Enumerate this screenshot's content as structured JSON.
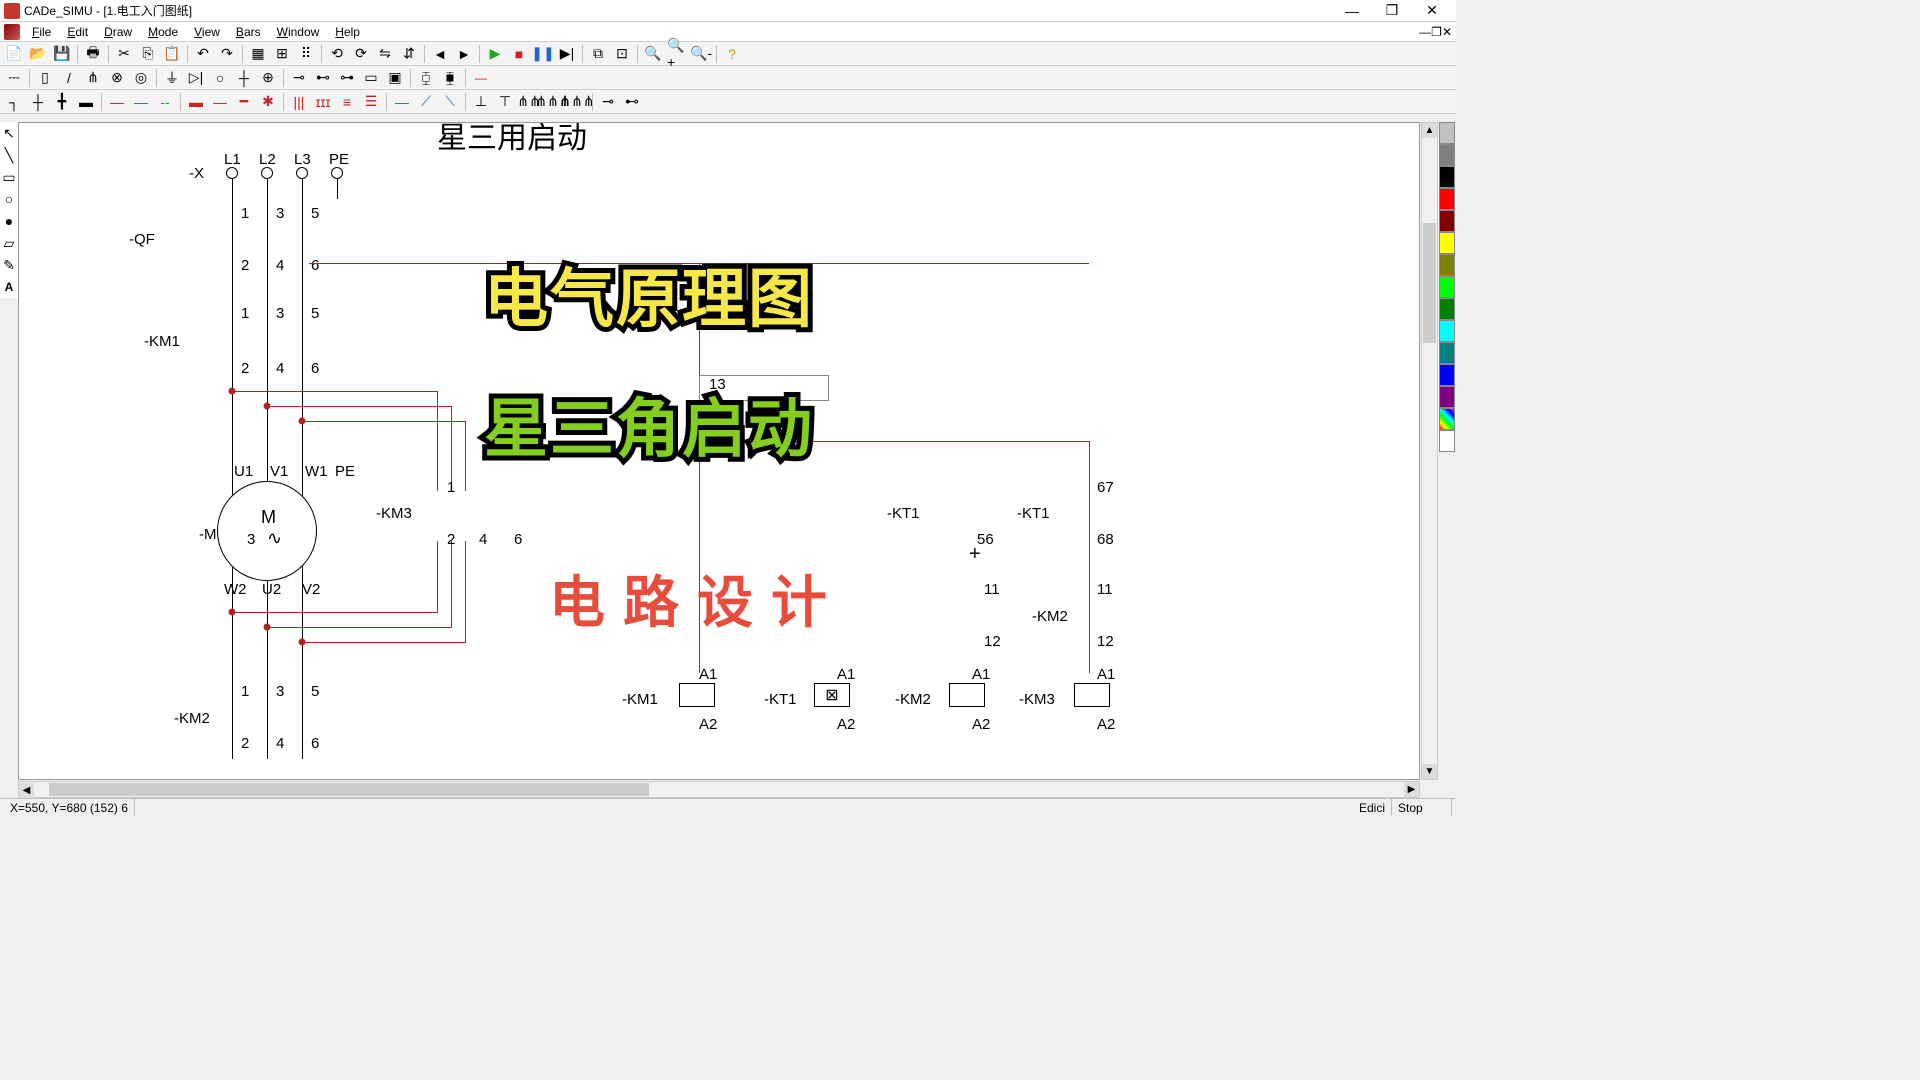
{
  "window": {
    "title": "CADe_SIMU - [1.电工入门图纸]",
    "minimize": "—",
    "maximize": "❐",
    "close": "✕"
  },
  "mdi": {
    "min": "—",
    "restore": "❐",
    "close": "✕"
  },
  "menu": {
    "file": "File",
    "file_u": "F",
    "edit": "Edit",
    "edit_u": "E",
    "draw": "Draw",
    "draw_u": "D",
    "mode": "Mode",
    "mode_u": "M",
    "view": "View",
    "view_u": "V",
    "bars": "Bars",
    "bars_u": "B",
    "window": "Window",
    "window_u": "W",
    "help": "Help",
    "help_u": "H"
  },
  "status": {
    "coords": "X=550, Y=680 (152) 6",
    "edit_mode": "Edici",
    "sim_state": "Stop"
  },
  "canvas": {
    "doc_title": "星三用启动",
    "terminals": {
      "x": "-X",
      "l1": "L1",
      "l2": "L2",
      "l3": "L3",
      "pe": "PE"
    },
    "qf": "-QF",
    "km1": "-KM1",
    "km2": "-KM2",
    "km3": "-KM3",
    "kt1": "-KT1",
    "motor": {
      "ref": "-M",
      "m": "M",
      "three": "3",
      "u1": "U1",
      "v1": "V1",
      "w1": "W1",
      "pe": "PE",
      "w2": "W2",
      "u2": "U2",
      "v2": "V2"
    },
    "pins": {
      "p1": "1",
      "p2": "2",
      "p3": "3",
      "p4": "4",
      "p5": "5",
      "p6": "6",
      "p11": "11",
      "p12": "12",
      "p56": "56",
      "p67": "67",
      "p68": "68",
      "a1": "A1",
      "a2": "A2",
      "p13": "13"
    }
  },
  "overlay": {
    "line1": "电气原理图",
    "line2": "星三角启动",
    "line3": "电路设计"
  },
  "palette": [
    "#c0c0c0",
    "#808080",
    "#000000",
    "#ff0000",
    "#800000",
    "#ffff00",
    "#808000",
    "#00ff00",
    "#008000",
    "#00ffff",
    "#008080",
    "#0000ff",
    "#800080",
    "rainbow",
    "#ffffff"
  ]
}
